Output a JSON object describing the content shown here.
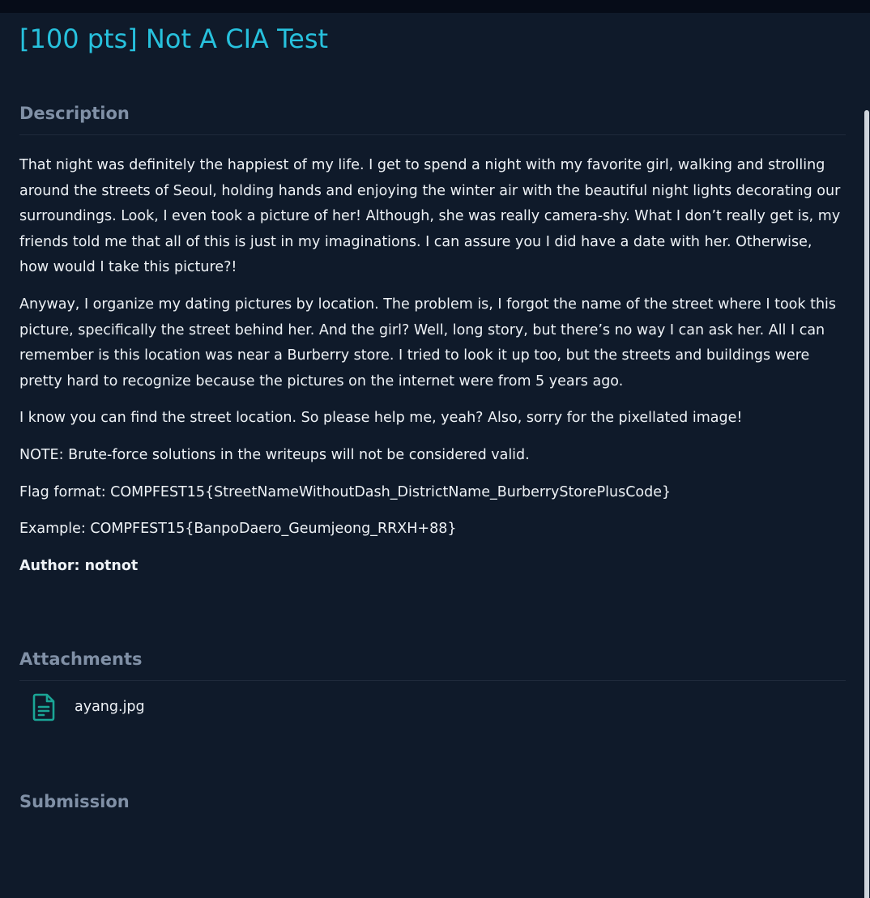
{
  "challenge": {
    "title": "[100 pts] Not A CIA Test"
  },
  "description": {
    "heading": "Description",
    "paragraphs": [
      "That night was definitely the happiest of my life. I get to spend a night with my favorite girl, walking and strolling around the streets of Seoul, holding hands and enjoying the winter air with the beautiful night lights decorating our surroundings. Look, I even took a picture of her! Although, she was really camera-shy. What I don’t really get is, my friends told me that all of this is just in my imaginations. I can assure you I did have a date with her. Otherwise, how would I take this picture?!",
      "Anyway, I organize my dating pictures by location. The problem is, I forgot the name of the street where I took this picture, specifically the street behind her. And the girl? Well, long story, but there’s no way I can ask her. All I can remember is this location was near a Burberry store. I tried to look it up too, but the streets and buildings were pretty hard to recognize because the pictures on the internet were from 5 years ago.",
      "I know you can find the street location. So please help me, yeah? Also, sorry for the pixellated image!",
      "NOTE: Brute-force solutions in the writeups will not be considered valid.",
      "Flag format: COMPFEST15{StreetNameWithoutDash_DistrictName_BurberryStorePlusCode}",
      "Example: COMPFEST15{BanpoDaero_Geumjeong_RRXH+88}"
    ],
    "author": "Author: notnot"
  },
  "attachments": {
    "heading": "Attachments",
    "files": [
      {
        "name": "ayang.jpg",
        "icon": "file-icon"
      }
    ]
  },
  "submission": {
    "heading": "Submission"
  },
  "colors": {
    "background": "#0f1a2a",
    "title": "#27c1dd",
    "heading": "#8090a6",
    "icon": "#1aa596"
  }
}
